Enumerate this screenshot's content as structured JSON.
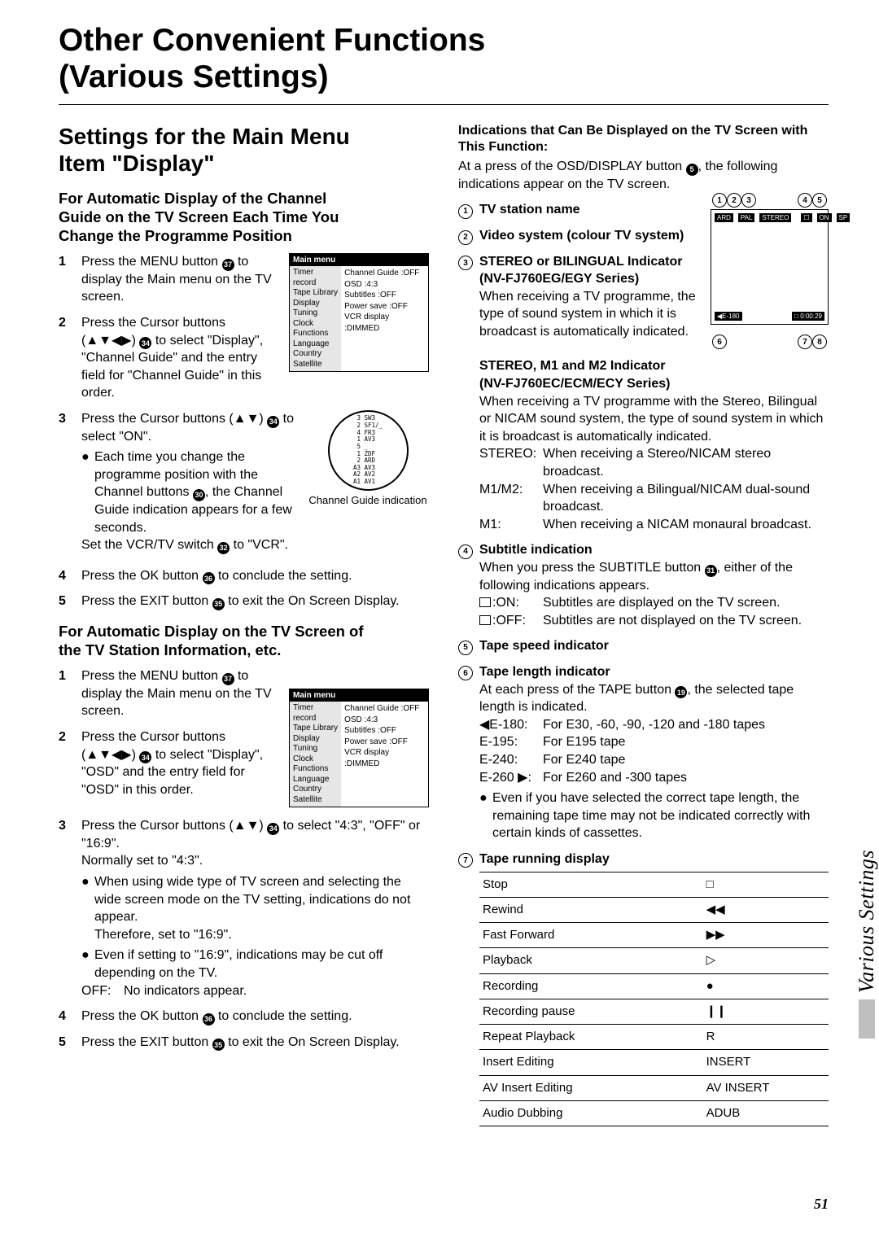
{
  "title1": "Other Convenient Functions",
  "title2": "(Various Settings)",
  "side_tab": "Various Settings",
  "page_num": "51",
  "left": {
    "h2a": "Settings for the Main Menu",
    "h2b": "Item \"Display\"",
    "sec1_h3a": "For Automatic Display of the Channel",
    "sec1_h3b": "Guide on the TV Screen Each Time You",
    "sec1_h3c": "Change the Programme Position",
    "s1_1a": "Press the MENU button ",
    "s1_1b": " to display the Main menu on the TV screen.",
    "s1_2a": "Press the Cursor buttons (",
    "s1_2b": ") ",
    "s1_2c": " to select \"Display\", \"Channel Guide\" and the entry field for \"Channel Guide\" in this order.",
    "s1_3a": "Press the Cursor buttons (",
    "s1_3b": ") ",
    "s1_3c": " to select \"ON\".",
    "s1_3_bul1a": "Each time you change the programme position with the Channel buttons ",
    "s1_3_bul1b": ", the Channel Guide indication appears for a few seconds.",
    "s1_3_line2a": "Set the VCR/TV switch ",
    "s1_3_line2b": " to \"VCR\".",
    "s1_4a": "Press the OK button ",
    "s1_4b": " to conclude the setting.",
    "s1_5a": "Press the EXIT button ",
    "s1_5b": " to exit the On Screen Display.",
    "sec2_h3a": "For Automatic Display on the TV Screen of",
    "sec2_h3b": "the TV Station Information, etc.",
    "s2_1a": "Press the MENU button ",
    "s2_1b": " to display the Main menu on the TV screen.",
    "s2_2a": "Press the Cursor buttons (",
    "s2_2b": ") ",
    "s2_2c": " to select \"Display\", \"OSD\" and the entry field for \"OSD\" in this order.",
    "s2_3a": "Press the Cursor buttons (",
    "s2_3b": ") ",
    "s2_3c": " to select \"4:3\", \"OFF\" or \"16:9\".",
    "s2_3_line": "Normally set to \"4:3\".",
    "s2_3_bul1": "When using wide type of TV screen and selecting the wide screen mode on the TV setting, indications do not appear.",
    "s2_3_bul1b": "Therefore, set to \"16:9\".",
    "s2_3_bul2": "Even if setting to \"16:9\", indications may be cut off depending on the TV.",
    "s2_3_off_k": "OFF:",
    "s2_3_off_v": "No indicators appear.",
    "s2_4a": "Press the OK button ",
    "s2_4b": " to conclude the setting.",
    "s2_5a": "Press the EXIT button ",
    "s2_5b": " to exit the On Screen Display.",
    "mainmenu_title": "Main menu",
    "menu_items": [
      "Timer record",
      "Tape Library",
      "Display",
      "Tuning",
      "Clock",
      "Functions",
      "Language",
      "Country",
      "Satellite"
    ],
    "menu_vals": [
      "Channel Guide :OFF",
      "OSD :4:3",
      "Subtitles :OFF",
      "Power save :OFF",
      "VCR display :DIMMED"
    ],
    "chg_circle": " 3 SW3\n 2 SF1/_\n 4 FR3\n 1 AV3\n 5 _\n 1 ZDF\n 2 ARD\nA3 AV3\nA2 AV2\nA1 AV1",
    "chg_caption": "Channel Guide indication"
  },
  "right": {
    "head1": "Indications that Can Be Displayed on the TV Screen with",
    "head2": "This Function:",
    "lead_a": "At a press of the OSD/DISPLAY button ",
    "lead_b": ", the following indications appear on the TV screen.",
    "ind1": "TV station name",
    "ind2": "Video system (colour TV system)",
    "ind3a": "STEREO or BILINGUAL Indicator",
    "ind3b": "(NV-FJ760EG/EGY Series)",
    "ind3c": "When receiving a TV programme, the type of sound system in which it is broadcast is automatically indicated.",
    "ind3d": "STEREO, M1 and M2 Indicator",
    "ind3e": "(NV-FJ760EC/ECM/ECY Series)",
    "ind3f": "When receiving a TV programme with the Stereo, Bilingual or NICAM sound system, the type of sound system in which it is broadcast is automatically indicated.",
    "ind3_stereo_k": "STEREO:",
    "ind3_stereo_v": "When receiving a Stereo/NICAM stereo broadcast.",
    "ind3_m1m2_k": "M1/M2:",
    "ind3_m1m2_v": "When receiving a Bilingual/NICAM dual-sound broadcast.",
    "ind3_m1_k": "M1:",
    "ind3_m1_v": "When receiving a NICAM monaural broadcast.",
    "ind4a": "Subtitle indication",
    "ind4b_a": "When you press the SUBTITLE button ",
    "ind4b_b": ", either of the following indications appears.",
    "ind4_on_k": ":ON:",
    "ind4_on_v": "Subtitles are displayed on the TV screen.",
    "ind4_off_k": ":OFF:",
    "ind4_off_v": "Subtitles are not displayed on the TV screen.",
    "ind5": "Tape speed indicator",
    "ind6a": "Tape length indicator",
    "ind6b_a": "At each press of the TAPE button ",
    "ind6b_b": ", the selected tape length is indicated.",
    "ind6_e180_k": "◀E-180:",
    "ind6_e180_v": "For E30, -60, -90, -120 and -180 tapes",
    "ind6_e195_k": "E-195:",
    "ind6_e195_v": "For E195 tape",
    "ind6_e240_k": "E-240:",
    "ind6_e240_v": "For E240 tape",
    "ind6_e260_k": "E-260 ▶:",
    "ind6_e260_v": "For E260 and -300 tapes",
    "ind6_bul": "Even if you have selected the correct tape length, the remaining tape time may not be indicated correctly with certain kinds of cassettes.",
    "ind7": "Tape running display",
    "table": [
      [
        "Stop",
        "□"
      ],
      [
        "Rewind",
        "◀◀"
      ],
      [
        "Fast Forward",
        "▶▶"
      ],
      [
        "Playback",
        "▷"
      ],
      [
        "Recording",
        "●"
      ],
      [
        "Recording pause",
        "❙❙"
      ],
      [
        "Repeat Playback",
        "R"
      ],
      [
        "Insert Editing",
        "INSERT"
      ],
      [
        "AV Insert Editing",
        "AV INSERT"
      ],
      [
        "Audio Dubbing",
        "ADUB"
      ]
    ],
    "screen": {
      "top_nums": [
        "1",
        "2",
        "3",
        "4",
        "5"
      ],
      "bot_nums": [
        "6",
        "7",
        "8"
      ],
      "row1": [
        "ARD",
        "PAL",
        "STEREO"
      ],
      "row1b": [
        "☐",
        "ON",
        "SP"
      ],
      "bot_l": "◀E-180",
      "bot_r": "□ 0:00:29"
    }
  },
  "btns": {
    "b37": "37",
    "b34": "34",
    "b30": "30",
    "b32": "32",
    "b36": "36",
    "b35": "35",
    "b5": "5",
    "b31": "31",
    "b19": "19"
  }
}
